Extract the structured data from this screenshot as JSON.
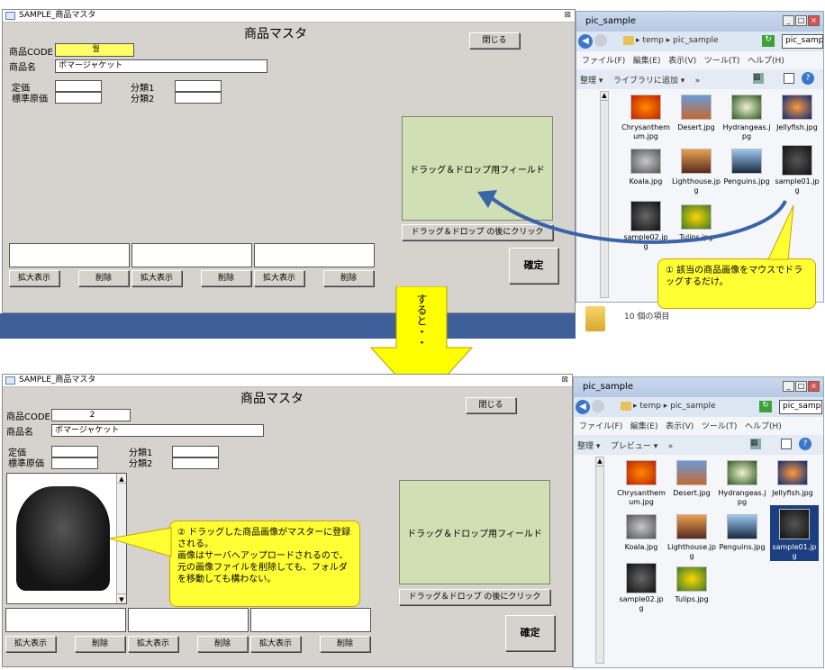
{
  "form_title": "SAMPLE_商品マスタ",
  "heading": "商品マスタ",
  "close_label": "閉じる",
  "labels": {
    "code": "商品CODE",
    "name": "商品名",
    "price": "定価",
    "cost": "標準原価",
    "cat1": "分類1",
    "cat2": "分類2"
  },
  "before": {
    "code_value": "월",
    "name_value": "ボマージャケット"
  },
  "after": {
    "code_value": "2",
    "name_value": "ボマージャケット"
  },
  "drop_field": "ドラッグ＆ドロップ用フィールド",
  "drop_hint": "ドラッグ＆ドロップ の後にクリック",
  "zoom_label": "拡大表示",
  "delete_label": "削除",
  "confirm_label": "確定",
  "explorer": {
    "title": "pic_sample",
    "breadcrumb": "▸ temp ▸ pic_sample",
    "search_value": "pic_sampl...",
    "menu": [
      "ファイル(F)",
      "編集(E)",
      "表示(V)",
      "ツール(T)",
      "ヘルプ(H)"
    ],
    "toolbar_top": [
      "整理 ▾",
      "ライブラリに追加 ▾",
      "»"
    ],
    "toolbar_bottom": [
      "整理 ▾",
      "プレビュー ▾",
      "»"
    ],
    "status": "10 個の項目",
    "files": [
      "Chrysanthemum.jpg",
      "Desert.jpg",
      "Hydrangeas.jpg",
      "Jellyfish.jpg",
      "Koala.jpg",
      "Lighthouse.jpg",
      "Penguins.jpg",
      "sample01.jpg",
      "sample02.jpg",
      "Tulips.jpg"
    ]
  },
  "arrow_text": "すると・・",
  "callout1": "① 該当の商品画像をマウスでドラッグするだけ。",
  "callout2": "② ドラッグした商品画像がマスターに登録される。\n画像はサーバへアップロードされるので、元の画像ファイルを削除しても、フォルダを移動しても構わない。"
}
